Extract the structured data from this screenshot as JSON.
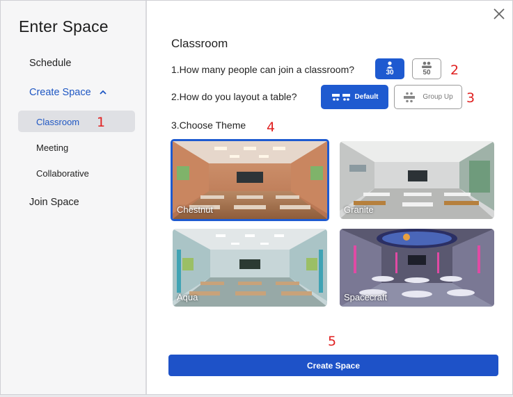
{
  "app": {
    "title": "Enter Space"
  },
  "sidebar": {
    "schedule": "Schedule",
    "create_space": "Create Space",
    "sub_items": [
      "Classroom",
      "Meeting",
      "Collaborative"
    ],
    "join_space": "Join Space"
  },
  "main": {
    "section_title": "Classroom",
    "questions": [
      "1.How many people can join a classroom?",
      "2.How do you layout a table?",
      "3.Choose Theme"
    ],
    "capacity_options": [
      {
        "value": "30",
        "selected": true
      },
      {
        "value": "50",
        "selected": false
      }
    ],
    "layout_options": [
      {
        "label": "Default",
        "selected": true
      },
      {
        "label": "Group Up",
        "selected": false
      }
    ],
    "themes": [
      {
        "name": "Chestnut",
        "selected": true
      },
      {
        "name": "Granite",
        "selected": false
      },
      {
        "name": "Aqua",
        "selected": false
      },
      {
        "name": "Spacecraft",
        "selected": false
      }
    ],
    "create_button": "Create Space"
  },
  "annotations": [
    "1",
    "2",
    "3",
    "4",
    "5"
  ],
  "colors": {
    "accent": "#1e5ad0",
    "annotation": "#e02020"
  },
  "icons": [
    "close-icon",
    "chevron-up-icon",
    "person-icon",
    "people-icon",
    "table-default-icon",
    "table-group-icon"
  ]
}
